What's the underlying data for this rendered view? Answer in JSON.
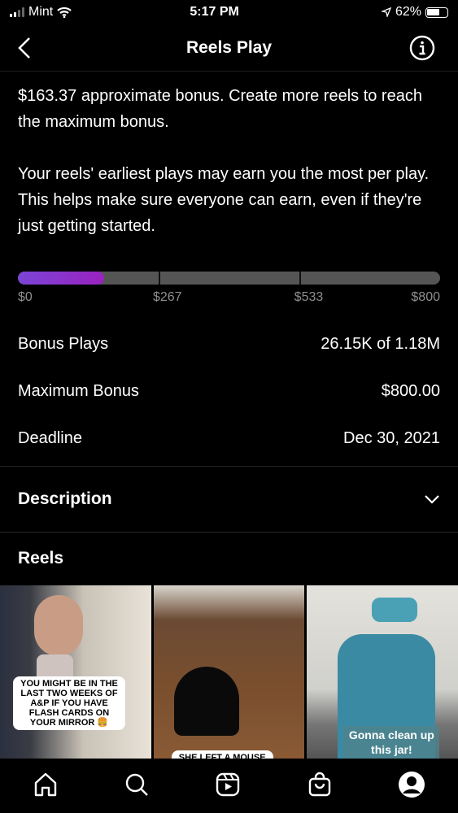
{
  "status_bar": {
    "carrier": "Mint",
    "time": "5:17 PM",
    "battery": "62%"
  },
  "header": {
    "title": "Reels Play"
  },
  "intro": {
    "p1": "$163.37 approximate bonus. Create more reels to reach the maximum bonus.",
    "p2": "Your reels' earliest plays may earn you the most per play. This helps make sure everyone can earn, even if they're just getting started."
  },
  "progress": {
    "value": 163.37,
    "max": 800,
    "fill_color": "#8a30cc",
    "ticks": [
      "$0",
      "$267",
      "$533",
      "$800"
    ]
  },
  "stats": [
    {
      "label": "Bonus Plays",
      "value": "26.15K of 1.18M"
    },
    {
      "label": "Maximum Bonus",
      "value": "$800.00"
    },
    {
      "label": "Deadline",
      "value": "Dec 30, 2021"
    }
  ],
  "description": {
    "label": "Description"
  },
  "reels": {
    "heading": "Reels",
    "items": [
      {
        "caption": "YOU MIGHT BE IN THE LAST TWO WEEKS OF A&P IF YOU HAVE FLASH CARDS ON YOUR MIRROR 🍔"
      },
      {
        "caption": "SHE LEFT A MOUSE IN"
      },
      {
        "caption": "Gonna clean up this jar!"
      }
    ]
  },
  "nav": [
    "home-icon",
    "search-icon",
    "reels-icon",
    "shop-icon",
    "profile-icon"
  ]
}
